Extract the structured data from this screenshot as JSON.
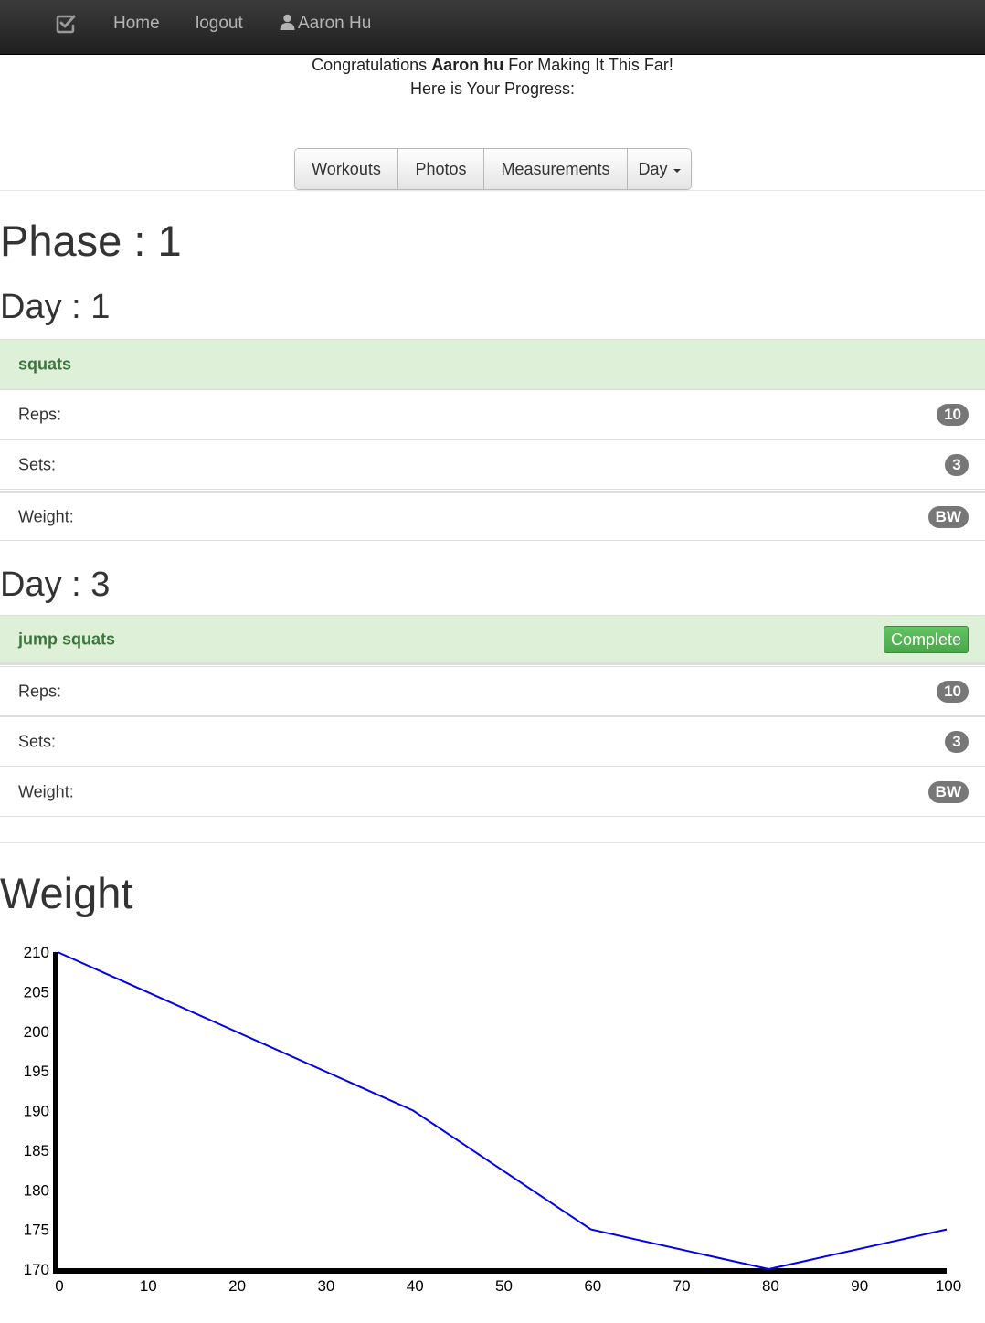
{
  "navbar": {
    "home_label": "Home",
    "logout_label": "logout",
    "user_label": "Aaron Hu",
    "text_color": "#b4b4b4"
  },
  "greeting": {
    "prefix": "Congratulations",
    "name": "Aaron hu",
    "suffix": "For Making It This Far!",
    "line2": "Here is Your Progress:"
  },
  "tabs": {
    "workouts": "Workouts",
    "photos": "Photos",
    "measurements": "Measurements",
    "day": "Day"
  },
  "phase_title": "Phase : 1",
  "days": [
    {
      "title": "Day : 1",
      "exercise": "squats",
      "reps_label": "Reps:",
      "reps": "10",
      "sets_label": "Sets:",
      "sets": "3",
      "weight_label": "Weight:",
      "weight": "BW"
    },
    {
      "title": "Day : 3",
      "exercise": "jump squats",
      "status_button": "Complete",
      "reps_label": "Reps:",
      "reps": "10",
      "sets_label": "Sets:",
      "sets": "3",
      "weight_label": "Weight:",
      "weight": "BW"
    }
  ],
  "weight_heading": "Weight",
  "colors": {
    "success_bg": "#dff0d8",
    "success_text": "#3c763d",
    "badge": "#777777",
    "complete_button": "#4aa84a",
    "line": "#0000ee"
  },
  "chart_data": {
    "type": "line",
    "x": [
      0,
      20,
      40,
      60,
      80,
      100
    ],
    "series": [
      {
        "values": [
          210,
          200,
          190,
          175,
          170,
          175
        ]
      }
    ],
    "xlim": [
      0,
      100
    ],
    "ylim": [
      170,
      210
    ],
    "xticks": [
      0,
      10,
      20,
      30,
      40,
      50,
      60,
      70,
      80,
      90,
      100
    ],
    "yticks": [
      170,
      175,
      180,
      185,
      190,
      195,
      200,
      205,
      210
    ],
    "grid": false,
    "xlabel": "",
    "ylabel": "",
    "title": ""
  }
}
